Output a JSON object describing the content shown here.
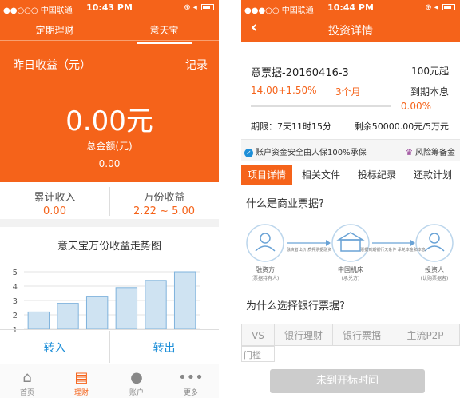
{
  "screen1": {
    "status": {
      "carrier": "●●○○○ 中国联通",
      "time": "10:43 PM"
    },
    "tabs": [
      "定期理财",
      "意天宝"
    ],
    "yesterday_label": "昨日收益（元）",
    "record_label": "记录",
    "big_amount": "0.00元",
    "total_label": "总金额(元)",
    "total_value": "0.00",
    "stats": [
      {
        "label": "累计收入",
        "value": "0.00"
      },
      {
        "label": "万份收益",
        "value": "2.22 ~ 5.00"
      }
    ],
    "chart_title": "意天宝万份收益走势图",
    "chart_data": {
      "type": "bar",
      "title": "意天宝万份收益走势图",
      "values": [
        2.2,
        2.8,
        3.3,
        3.9,
        4.4,
        5.0
      ],
      "yticks": [
        "5",
        "4",
        "3",
        "2",
        "1"
      ],
      "ylim": [
        1,
        5
      ]
    },
    "buttons": {
      "in": "转入",
      "out": "转出"
    },
    "tabbar": [
      {
        "icon": "home-icon",
        "glyph": "⌂",
        "label": "首页"
      },
      {
        "icon": "card-icon",
        "glyph": "▤",
        "label": "理财"
      },
      {
        "icon": "user-icon",
        "glyph": "●",
        "label": "账户"
      },
      {
        "icon": "more-icon",
        "glyph": "•••",
        "label": "更多"
      }
    ]
  },
  "screen2": {
    "status": {
      "carrier": "●●●○○ 中国联通",
      "time": "10:44 PM"
    },
    "title": "投资详情",
    "product_name": "意票据-20160416-3",
    "min_amount": "100元起",
    "rate": "14.00+1.50%",
    "term": "3个月",
    "repay": "到期本息",
    "progress_pct_label": "0.00%",
    "progress_fraction": 0.0,
    "deadline": "期限：7天11时15分",
    "remaining": "剩余50000.00元/5万元",
    "safe_text": "账户资金安全由人保100%承保",
    "risk_text": "风险筹备金",
    "detail_tabs": [
      "项目详情",
      "相关文件",
      "投标纪录",
      "还款计划"
    ],
    "q1": "什么是商业票据?",
    "flow": {
      "n1": "融资方",
      "n1_sub": "(票据持有人)",
      "a1": "融资者出价 质押票据融资",
      "n2": "中国机床",
      "n2_sub": "(承兑方)",
      "a2": "票据到期银行无条件 承兑本金和本息",
      "n3": "投资人",
      "n3_sub": "(认购票据者)"
    },
    "q2": "为什么选择银行票据?",
    "table_headers": [
      "VS",
      "银行理财",
      "银行票据",
      "主流P2P"
    ],
    "table_row_start": "门槛",
    "bottom_button": "未到开标时间"
  }
}
